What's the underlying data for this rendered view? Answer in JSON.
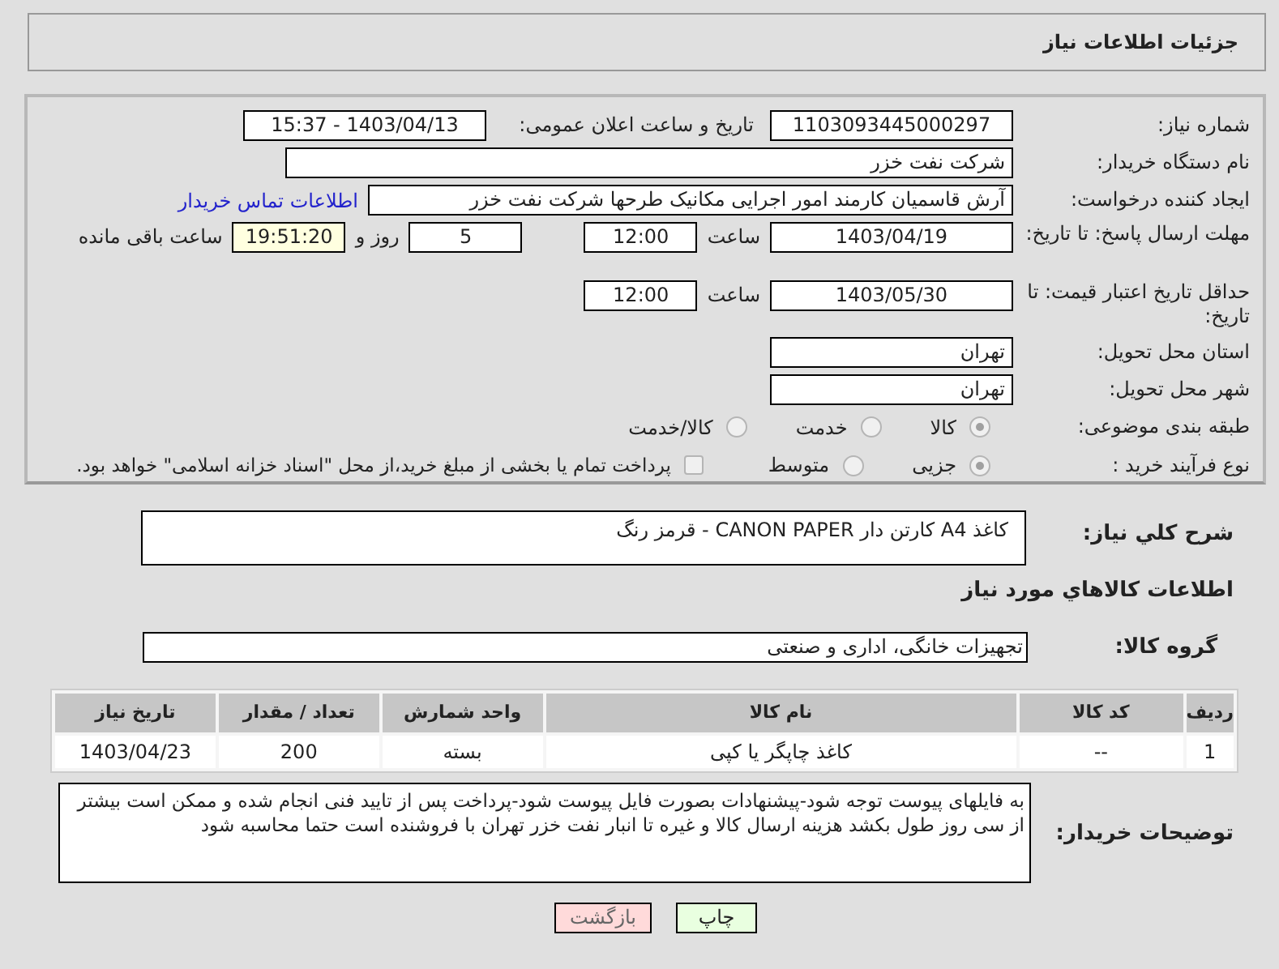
{
  "header": {
    "title": "جزئیات اطلاعات نیاز"
  },
  "fields": {
    "need_number_label": "شماره نیاز:",
    "need_number": "1103093445000297",
    "announce_label": "تاریخ و ساعت اعلان عمومی:",
    "announce": "1403/04/13 - 15:37",
    "buyer_label": "نام دستگاه خریدار:",
    "buyer": "شرکت نفت خزر",
    "creator_label": "ایجاد کننده درخواست:",
    "creator": "آرش قاسمیان کارمند امور اجرایی مکانیک طرحها شرکت نفت خزر",
    "contact_link": "اطلاعات تماس خریدار",
    "deadline_label": "مهلت ارسال پاسخ: تا تاریخ:",
    "deadline_date": "1403/04/19",
    "time_label": "ساعت",
    "deadline_time": "12:00",
    "days": "5",
    "days_label": "روز و",
    "remaining": "19:51:20",
    "remaining_label": "ساعت باقی مانده",
    "validity_label": "حداقل تاریخ اعتبار قیمت: تا تاریخ:",
    "validity_date": "1403/05/30",
    "validity_time_label": "ساعت",
    "validity_time": "12:00",
    "province_label": "استان محل تحویل:",
    "province": "تهران",
    "city_label": "شهر محل تحویل:",
    "city": "تهران"
  },
  "category": {
    "label": "طبقه بندی موضوعی:",
    "options": [
      {
        "label": "کالا",
        "selected": true
      },
      {
        "label": "خدمت",
        "selected": false
      },
      {
        "label": "کالا/خدمت",
        "selected": false
      }
    ]
  },
  "process": {
    "label": "نوع فرآیند خرید :",
    "options": [
      {
        "label": "جزیی",
        "selected": true
      },
      {
        "label": "متوسط",
        "selected": false
      }
    ],
    "treasury": {
      "label": "پرداخت تمام یا بخشی از مبلغ خرید،از محل \"اسناد خزانه اسلامی\" خواهد بود.",
      "checked": false
    }
  },
  "description": {
    "label": "شرح کلي نياز:",
    "value": "کاغذ A4 کارتن دار  CANON PAPER  - قرمز رنگ"
  },
  "goods_title": "اطلاعات کالاهاي مورد نياز",
  "goods_group": {
    "label": "گروه کالا:",
    "value": "تجهیزات خانگی، اداری و صنعتی"
  },
  "table": {
    "columns": [
      "ردیف",
      "کد کالا",
      "نام کالا",
      "واحد شمارش",
      "تعداد / مقدار",
      "تاریخ نیاز"
    ],
    "rows": [
      [
        "1",
        "--",
        "کاغذ چاپگر یا کپی",
        "بسته",
        "200",
        "1403/04/23"
      ]
    ]
  },
  "notes": {
    "label": "توضیحات خریدار:",
    "value": "به فایلهای پیوست توجه شود-پیشنهادات بصورت فایل پیوست شود-پرداخت پس از تایید فنی انجام شده و ممکن است بیشتر از سی روز طول بکشد هزینه ارسال کالا و غیره تا انبار نفت خزر تهران با فروشنده است حتما محاسبه شود"
  },
  "buttons": {
    "print": "چاپ",
    "back": "بازگشت"
  }
}
